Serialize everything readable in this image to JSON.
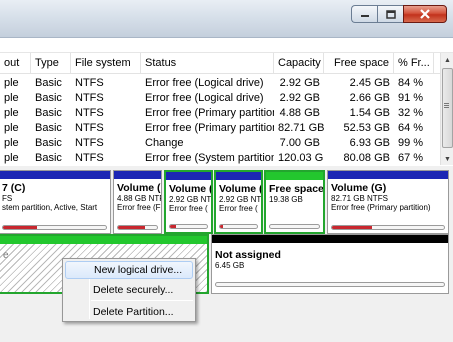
{
  "window": {
    "controls": {
      "minimize": "minimize-icon",
      "maximize": "maximize-icon",
      "close": "close-icon"
    }
  },
  "table": {
    "columns": [
      "out",
      "Type",
      "File system",
      "Status",
      "Capacity",
      "Free space",
      "% Fr..."
    ],
    "rows": [
      [
        "ple",
        "Basic",
        "NTFS",
        "Error free (Logical drive)",
        "2.92 GB",
        "2.45 GB",
        "84 %"
      ],
      [
        "ple",
        "Basic",
        "NTFS",
        "Error free (Logical drive)",
        "2.92 GB",
        "2.66 GB",
        "91 %"
      ],
      [
        "ple",
        "Basic",
        "NTFS",
        "Error free (Primary partition)",
        "4.88 GB",
        "1.54 GB",
        "32 %"
      ],
      [
        "ple",
        "Basic",
        "NTFS",
        "Error free (Primary partition)",
        "82.71 GB",
        "52.53 GB",
        "64 %"
      ],
      [
        "ple",
        "Basic",
        "NTFS",
        "Change",
        "7.00 GB",
        "6.93 GB",
        "99 %"
      ],
      [
        "ple",
        "Basic",
        "NTFS",
        "Error free (System partition, ...",
        "120.03 GB",
        "80.08 GB",
        "67 %"
      ]
    ]
  },
  "disk_map": {
    "volumes": [
      {
        "name": "7 (C)",
        "line1": "FS",
        "line2": "stem partition, Active, Start",
        "used_fraction": 0.33
      },
      {
        "name": "Volume (",
        "line1": "4.88 GB NTF",
        "line2": "Error free (F",
        "used_fraction": 0.68
      },
      {
        "name": "Volume (",
        "line1": "2.92 GB NT",
        "line2": "Error free (",
        "used_fraction": 0.16
      },
      {
        "name": "Volume (",
        "line1": "2.92 GB NT",
        "line2": "Error free (",
        "used_fraction": 0.09
      },
      {
        "name": "Free space",
        "line1": "19.38 GB",
        "line2": "",
        "used_fraction": 0
      },
      {
        "name": "Volume (G)",
        "line1": "82.71 GB NTFS",
        "line2": "Error free (Primary partition)",
        "used_fraction": 0.36
      }
    ],
    "extended_label": "e",
    "not_assigned": {
      "name": "Not assigned",
      "size": "6.45 GB"
    }
  },
  "context_menu": {
    "items": [
      "New logical drive...",
      "Delete securely...",
      "Delete Partition..."
    ]
  },
  "colors": {
    "primary_band": "#1c27b4",
    "free_band": "#23c72e",
    "unallocated_band": "#000000",
    "used_fill": "#c8272f",
    "selection_border": "#23a62e"
  }
}
